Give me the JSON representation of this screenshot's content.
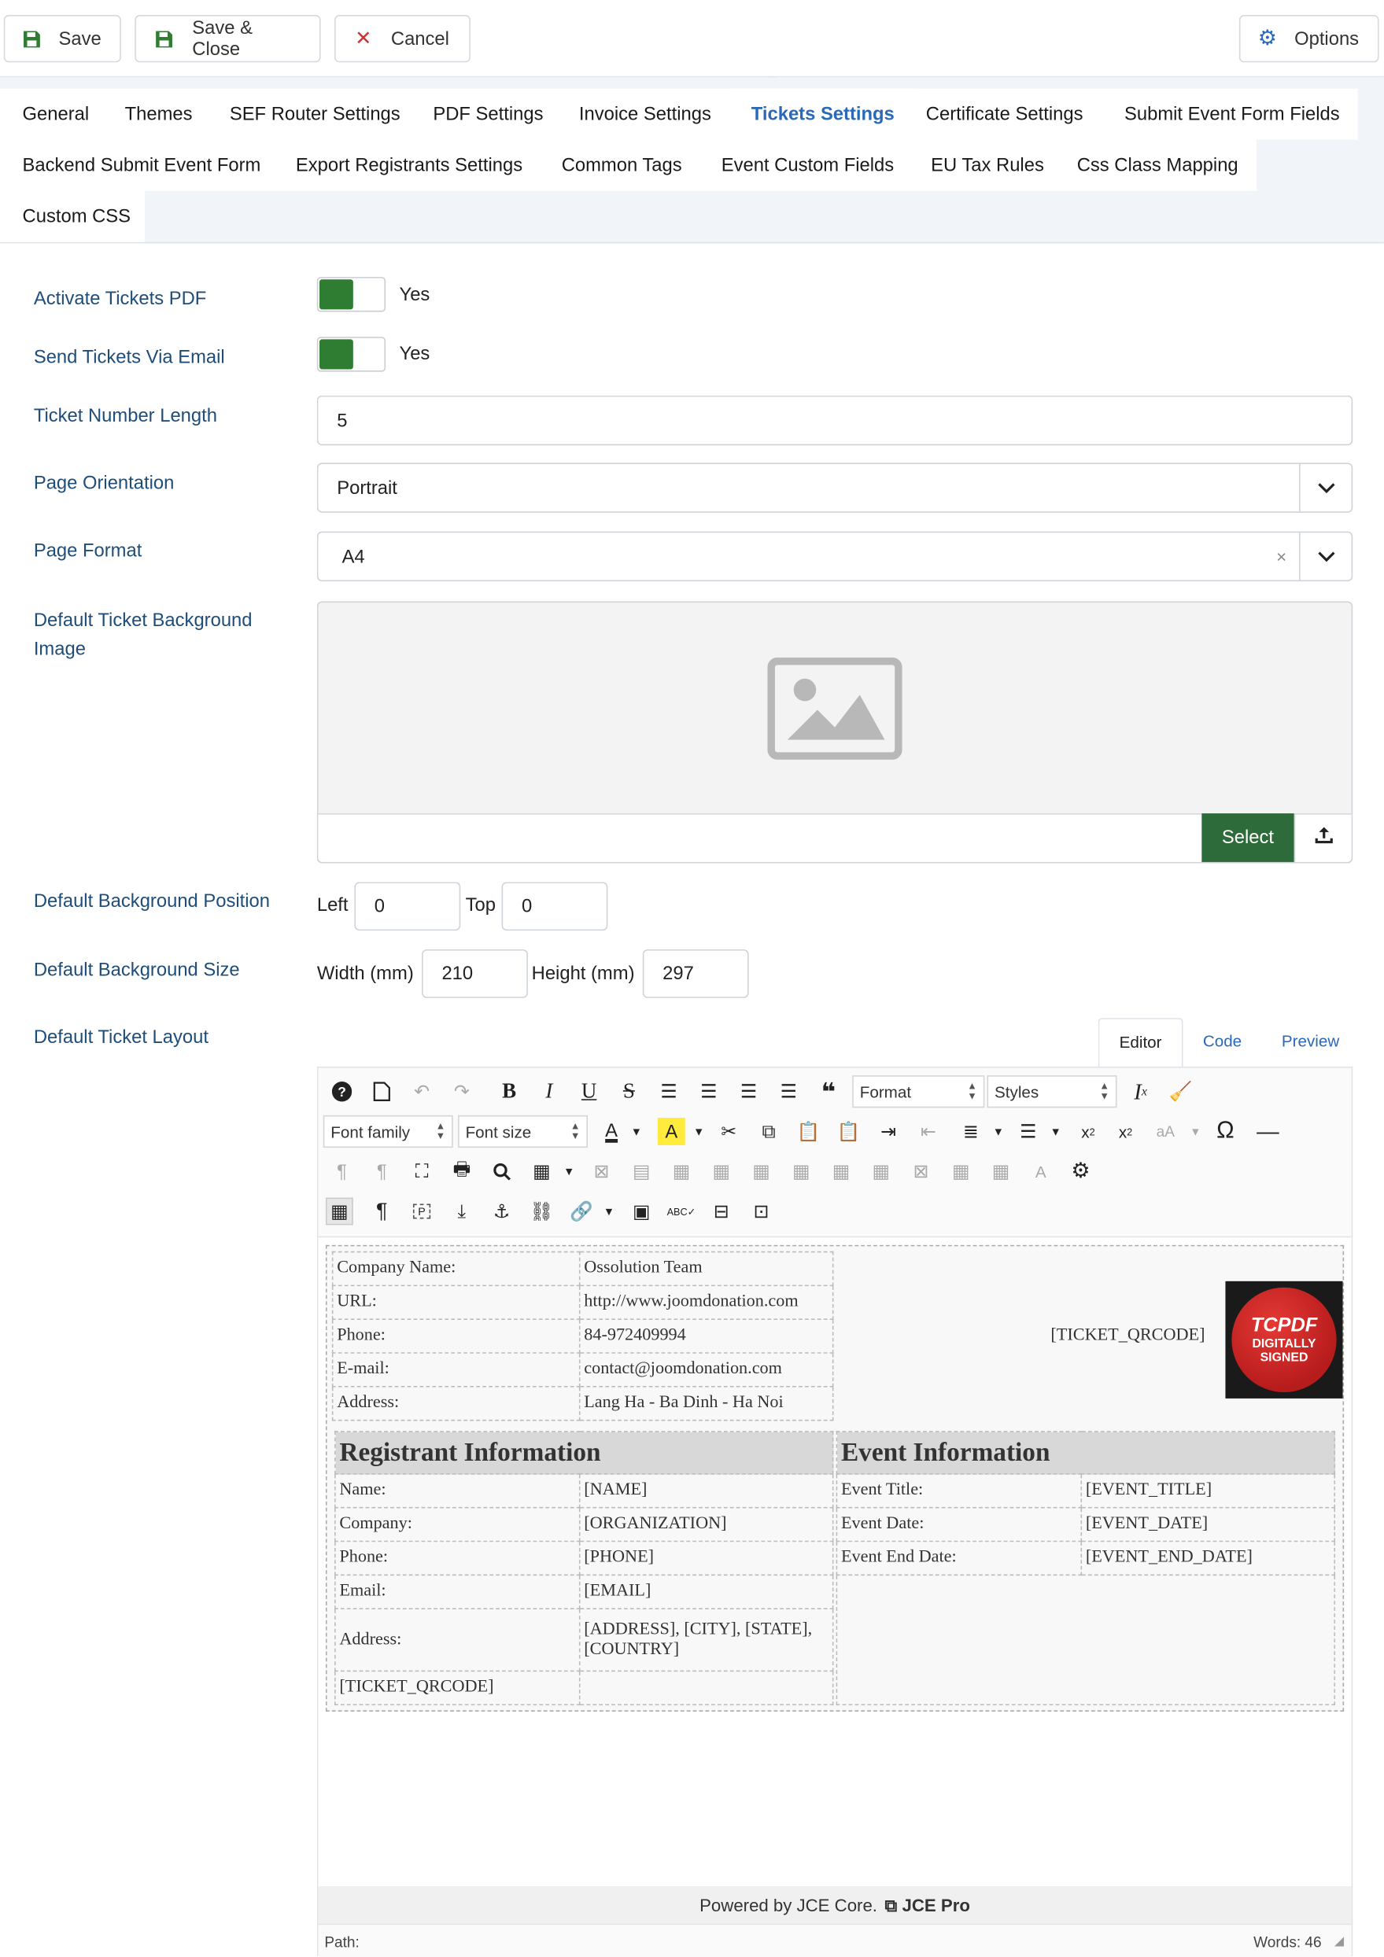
{
  "toolbar": {
    "save": "Save",
    "save_close": "Save & Close",
    "cancel": "Cancel",
    "options": "Options"
  },
  "tabs": [
    "General",
    "Themes",
    "SEF Router Settings",
    "PDF Settings",
    "Invoice Settings",
    "Tickets Settings",
    "Certificate Settings",
    "Submit Event Form Fields",
    "Backend Submit Event Form",
    "Export Registrants Settings",
    "Common Tags",
    "Event Custom Fields",
    "EU Tax Rules",
    "Css Class Mapping",
    "Custom CSS"
  ],
  "active_tab": "Tickets Settings",
  "form": {
    "activate_tickets_pdf": {
      "label": "Activate Tickets PDF",
      "value": "Yes"
    },
    "send_tickets_email": {
      "label": "Send Tickets Via Email",
      "value": "Yes"
    },
    "ticket_number_length": {
      "label": "Ticket Number Length",
      "value": "5"
    },
    "page_orientation": {
      "label": "Page Orientation",
      "value": "Portrait"
    },
    "page_format": {
      "label": "Page Format",
      "value": "A4",
      "clear": "×"
    },
    "background_image": {
      "label": "Default Ticket Background Image",
      "select": "Select"
    },
    "background_position": {
      "label": "Default Background Position",
      "left_label": "Left",
      "left": "0",
      "top_label": "Top",
      "top": "0"
    },
    "background_size": {
      "label": "Default Background Size",
      "width_label": "Width (mm)",
      "width": "210",
      "height_label": "Height (mm)",
      "height": "297"
    },
    "ticket_layout": {
      "label": "Default Ticket Layout"
    }
  },
  "editor": {
    "tabs": [
      "Editor",
      "Code",
      "Preview"
    ],
    "format": "Format",
    "styles": "Styles",
    "font_family": "Font family",
    "font_size": "Font size",
    "powered": "Powered by JCE Core.",
    "pro": "JCE Pro",
    "path": "Path:",
    "words": "Words: 46"
  },
  "ticket": {
    "company": [
      [
        "Company Name:",
        "Ossolution Team"
      ],
      [
        "URL:",
        "http://www.joomdonation.com"
      ],
      [
        "Phone:",
        "84-972409994"
      ],
      [
        "E-mail:",
        "contact@joomdonation.com"
      ],
      [
        "Address:",
        "Lang Ha - Ba Dinh - Ha Noi"
      ]
    ],
    "qr_tag": "[TICKET_QRCODE]",
    "badge_top": "TCPDF",
    "badge_mid": "DIGITALLY",
    "badge_bot": "SIGNED",
    "reg_title": "Registrant Information",
    "registrant": [
      [
        "Name:",
        "[NAME]"
      ],
      [
        "Company:",
        "[ORGANIZATION]"
      ],
      [
        "Phone:",
        "[PHONE]"
      ],
      [
        "Email:",
        "[EMAIL]"
      ]
    ],
    "address_label": "Address:",
    "address_value": "[ADDRESS], [CITY], [STATE], [COUNTRY]",
    "reg_qr": "[TICKET_QRCODE]",
    "event_title": "Event Information",
    "event": [
      [
        "Event Title:",
        "[EVENT_TITLE]"
      ],
      [
        "Event Date:",
        "[EVENT_DATE]"
      ],
      [
        "Event End Date:",
        "[EVENT_END_DATE]"
      ]
    ]
  }
}
